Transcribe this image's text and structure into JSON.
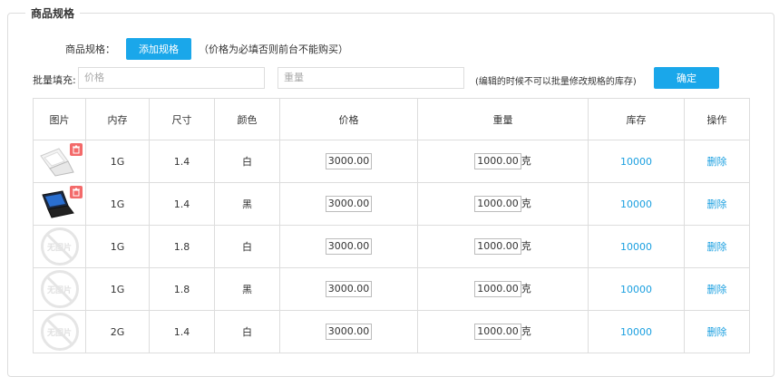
{
  "section": {
    "title": "商品规格"
  },
  "spec": {
    "label": "商品规格：",
    "add_button": "添加规格",
    "note": "（价格为必填否则前台不能购买）"
  },
  "batch": {
    "label": "批量填充:",
    "price_placeholder": "价格",
    "weight_placeholder": "重量",
    "note": "(编辑的时候不可以批量修改规格的库存)",
    "confirm_button": "确定"
  },
  "table": {
    "headers": [
      "图片",
      "内存",
      "尺寸",
      "颜色",
      "价格",
      "重量",
      "库存",
      "操作"
    ],
    "weight_unit": "克",
    "delete_label": "删除",
    "no_image_text": "无图片",
    "rows": [
      {
        "image": "laptop-white",
        "memory": "1G",
        "size": "1.4",
        "color": "白",
        "price": "3000.00",
        "weight": "1000.00",
        "stock": "10000"
      },
      {
        "image": "laptop-black",
        "memory": "1G",
        "size": "1.4",
        "color": "黑",
        "price": "3000.00",
        "weight": "1000.00",
        "stock": "10000"
      },
      {
        "image": "none",
        "memory": "1G",
        "size": "1.8",
        "color": "白",
        "price": "3000.00",
        "weight": "1000.00",
        "stock": "10000"
      },
      {
        "image": "none",
        "memory": "1G",
        "size": "1.8",
        "color": "黑",
        "price": "3000.00",
        "weight": "1000.00",
        "stock": "10000"
      },
      {
        "image": "none",
        "memory": "2G",
        "size": "1.4",
        "color": "白",
        "price": "3000.00",
        "weight": "1000.00",
        "stock": "10000"
      }
    ]
  },
  "colors": {
    "accent": "#1aa7ea",
    "link": "#1a9fe0",
    "trash": "#f36a6a"
  }
}
